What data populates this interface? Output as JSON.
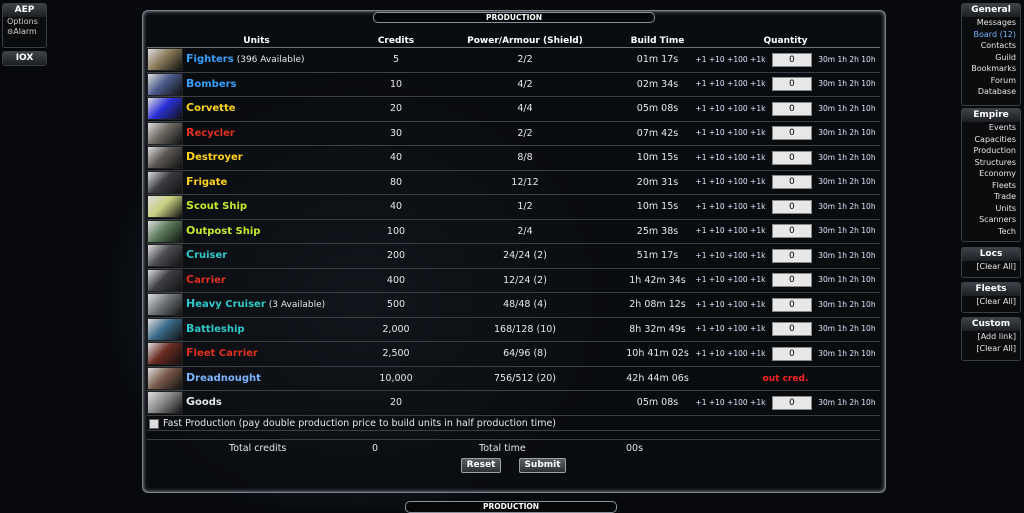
{
  "left": {
    "aep": {
      "title": "AEP",
      "options": "Options",
      "alarm": "Alarm"
    },
    "iox": {
      "title": "IOX"
    }
  },
  "right": {
    "general": {
      "title": "General",
      "items": [
        "Messages",
        "Board (12)",
        "Contacts",
        "Guild",
        "Bookmarks",
        "Forum",
        "Database"
      ]
    },
    "empire": {
      "title": "Empire",
      "items": [
        "Events",
        "Capacities",
        "Production",
        "Structures",
        "Economy",
        "Fleets",
        "Trade",
        "Units",
        "Scanners",
        "Tech"
      ]
    },
    "locs": {
      "title": "Locs",
      "items": [
        "[Clear All]"
      ]
    },
    "fleets": {
      "title": "Fleets",
      "items": [
        "[Clear All]"
      ]
    },
    "custom": {
      "title": "Custom",
      "items": [
        "[Add link]",
        "[Clear All]"
      ]
    }
  },
  "production": {
    "title": "PRODUCTION",
    "bottom_title": "PRODUCTION",
    "headers": {
      "units": "Units",
      "credits": "Credits",
      "power": "Power/Armour (Shield)",
      "build_time": "Build Time",
      "quantity": "Quantity"
    },
    "qty_buttons": "+1 +10 +100 +1k",
    "time_buttons": "30m 1h 2h 10h",
    "rows": [
      {
        "first": "F",
        "rest": "ighters",
        "note": "(396 Available)",
        "color": "#3aa0ff",
        "thumb": "#8a7a5a",
        "credits": "5",
        "power": "2/2",
        "time": "01m 17s",
        "qty": "0",
        "out": ""
      },
      {
        "first": "B",
        "rest": "ombers",
        "note": "",
        "color": "#3aa0ff",
        "thumb": "#4a5a8a",
        "credits": "10",
        "power": "4/2",
        "time": "02m 34s",
        "qty": "0",
        "out": ""
      },
      {
        "first": "C",
        "rest": "orvette",
        "note": "",
        "color": "#ffd21e",
        "thumb": "#2a30d8",
        "credits": "20",
        "power": "4/4",
        "time": "05m 08s",
        "qty": "0",
        "out": ""
      },
      {
        "first": "R",
        "rest": "ecycler",
        "note": "",
        "color": "#e03020",
        "thumb": "#6a6660",
        "credits": "30",
        "power": "2/2",
        "time": "07m 42s",
        "qty": "0",
        "out": ""
      },
      {
        "first": "D",
        "rest": "estroyer",
        "note": "",
        "color": "#ffd21e",
        "thumb": "#5a5652",
        "credits": "40",
        "power": "8/8",
        "time": "10m 15s",
        "qty": "0",
        "out": ""
      },
      {
        "first": "F",
        "rest": "rigate",
        "note": "",
        "color": "#ffd21e",
        "thumb": "#3a3c40",
        "credits": "80",
        "power": "12/12",
        "time": "20m 31s",
        "qty": "0",
        "out": ""
      },
      {
        "first": "S",
        "rest": "cout Ship",
        "note": "",
        "color": "#c8e830",
        "thumb": "#c8d080",
        "credits": "40",
        "power": "1/2",
        "time": "10m 15s",
        "qty": "0",
        "out": ""
      },
      {
        "first": "O",
        "rest": "utpost Ship",
        "note": "",
        "color": "#c8e830",
        "thumb": "#5a7a5a",
        "credits": "100",
        "power": "2/4",
        "time": "25m 38s",
        "qty": "0",
        "out": ""
      },
      {
        "first": "C",
        "rest": "ruiser",
        "note": "",
        "color": "#30c8c8",
        "thumb": "#4a4c50",
        "credits": "200",
        "power": "24/24 (2)",
        "time": "51m 17s",
        "qty": "0",
        "out": ""
      },
      {
        "first": "C",
        "rest": "arrier",
        "note": "",
        "color": "#e03020",
        "thumb": "#3c3e42",
        "credits": "400",
        "power": "12/24 (2)",
        "time": "1h 42m 34s",
        "qty": "0",
        "out": ""
      },
      {
        "first": "H",
        "rest": "eavy Cruiser",
        "note": "(3 Available)",
        "color": "#30c8c8",
        "thumb": "#707478",
        "credits": "500",
        "power": "48/48 (4)",
        "time": "2h 08m 12s",
        "qty": "0",
        "out": ""
      },
      {
        "first": "B",
        "rest": "attleship",
        "note": "",
        "color": "#30c8c8",
        "thumb": "#3a6a8a",
        "credits": "2,000",
        "power": "168/128 (10)",
        "time": "8h 32m 49s",
        "qty": "0",
        "out": ""
      },
      {
        "first": "F",
        "rest": "leet Carrier",
        "note": "",
        "color": "#e03020",
        "thumb": "#6a2a20",
        "credits": "2,500",
        "power": "64/96 (8)",
        "time": "10h 41m 02s",
        "qty": "0",
        "out": ""
      },
      {
        "first": "D",
        "rest": "readnought",
        "note": "",
        "color": "#79b4ff",
        "thumb": "#7a5a4a",
        "credits": "10,000",
        "power": "756/512 (20)",
        "time": "42h 44m 06s",
        "qty": "",
        "out": "out cred."
      },
      {
        "first": "G",
        "rest": "oods",
        "note": "",
        "color": "#e6e6e6",
        "thumb": "#8a8a8a",
        "credits": "20",
        "power": "",
        "time": "05m 08s",
        "qty": "0",
        "out": ""
      }
    ],
    "fast_production": "Fast Production (pay double production price to build units in half production time)",
    "total_credits_label": "Total credits",
    "total_credits": "0",
    "total_time_label": "Total time",
    "total_time": "00s",
    "reset": "Reset",
    "submit": "Submit"
  }
}
